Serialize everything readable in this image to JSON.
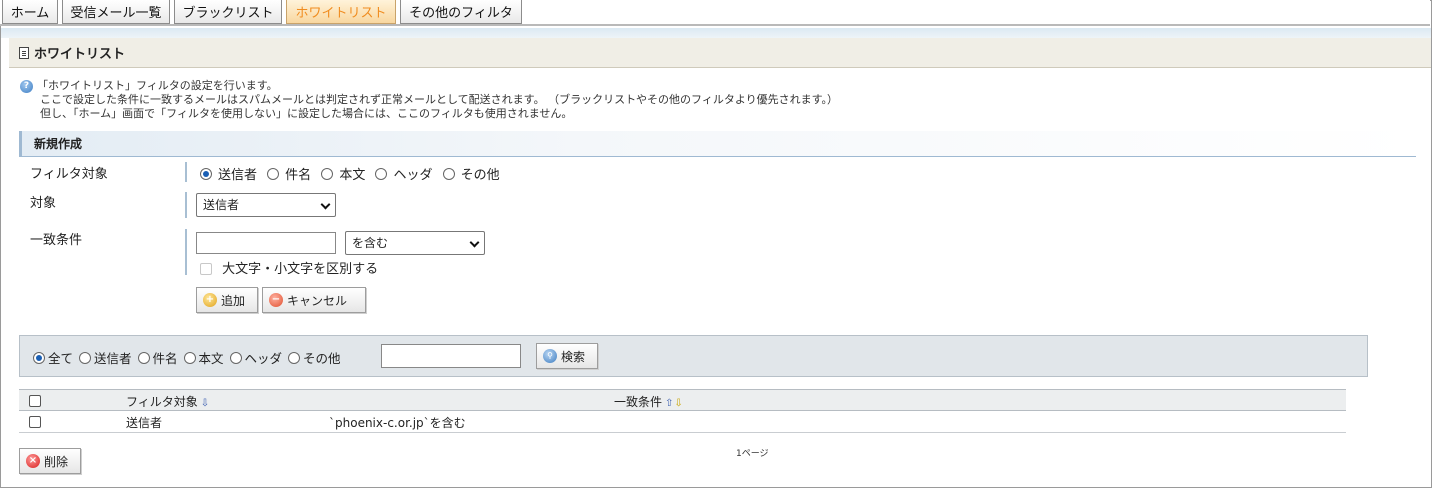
{
  "tabs": [
    {
      "label": "ホーム",
      "active": false
    },
    {
      "label": "受信メール一覧",
      "active": false
    },
    {
      "label": "ブラックリスト",
      "active": false
    },
    {
      "label": "ホワイトリスト",
      "active": true
    },
    {
      "label": "その他のフィルタ",
      "active": false
    }
  ],
  "page": {
    "title": "ホワイトリスト",
    "info": [
      "「ホワイトリスト」フィルタの設定を行います。",
      "ここで設定した条件に一致するメールはスパムメールとは判定されず正常メールとして配送されます。 （ブラックリストやその他のフィルタより優先されます。）",
      "但し、「ホーム」画面で「フィルタを使用しない」に設定した場合には、ここのフィルタも使用されません。"
    ]
  },
  "new_entry": {
    "section_title": "新規作成",
    "filter_target_label": "フィルタ対象",
    "filter_target_options": [
      "送信者",
      "件名",
      "本文",
      "ヘッダ",
      "その他"
    ],
    "filter_target_selected": "送信者",
    "target_label": "対象",
    "target_value": "送信者",
    "match_label": "一致条件",
    "match_text_value": "",
    "match_mode_value": "を含む",
    "case_sensitive_label": "大文字・小文字を区別する",
    "add_label": "追加",
    "cancel_label": "キャンセル"
  },
  "search": {
    "options": [
      "全て",
      "送信者",
      "件名",
      "本文",
      "ヘッダ",
      "その他"
    ],
    "selected": "全て",
    "query_value": "",
    "search_label": "検索"
  },
  "table": {
    "headers": {
      "filter_target": "フィルタ対象",
      "match_condition": "一致条件"
    },
    "rows": [
      {
        "filter_target": "送信者",
        "condition": "`phoenix-c.or.jp`を含む"
      }
    ]
  },
  "pager": {
    "text": "1ページ"
  },
  "delete_label": "削除",
  "colors": {
    "active_tab_text": "#f08c1f",
    "section_border": "#9fb9d2"
  }
}
